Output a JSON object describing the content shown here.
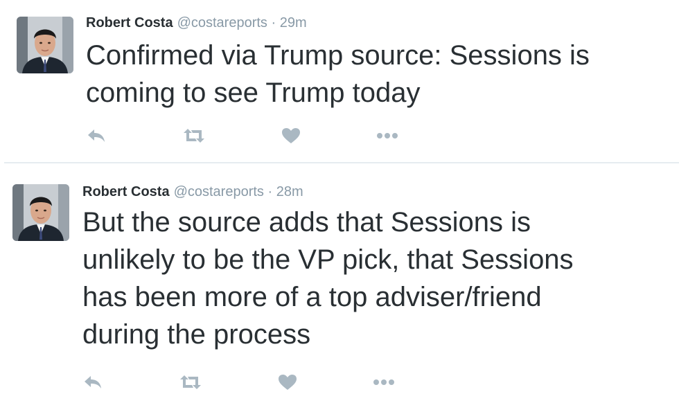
{
  "tweets": [
    {
      "author_name": "Robert Costa",
      "handle": "@costareports",
      "time": "· 29m",
      "lines": [
        "Confirmed via Trump source: Sessions is",
        "coming to see Trump today"
      ]
    },
    {
      "author_name": "Robert Costa",
      "handle": "@costareports",
      "time": "· 28m",
      "lines": [
        "But the source adds that Sessions is",
        "unlikely to be the VP pick, that Sessions",
        "has been more of a top adviser/friend",
        "during the process"
      ]
    }
  ],
  "icons": {
    "reply": "reply-icon",
    "retweet": "retweet-icon",
    "like": "heart-icon",
    "more": "more-icon"
  },
  "colors": {
    "text": "#292f33",
    "secondary": "#8899a6",
    "icon": "#aab8c2",
    "divider": "#e6ecf0"
  }
}
